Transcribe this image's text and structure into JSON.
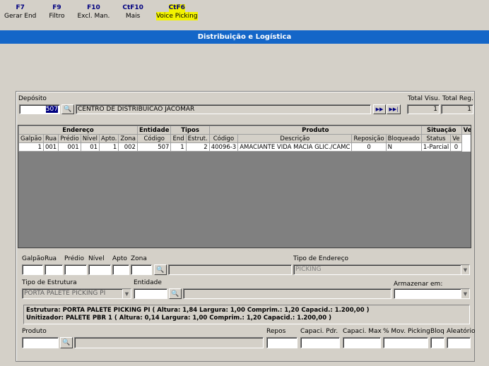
{
  "toolbar": [
    {
      "key": "F7",
      "label": "Gerar End",
      "highlight": false
    },
    {
      "key": "F9",
      "label": "Filtro",
      "highlight": false
    },
    {
      "key": "F10",
      "label": "Excl. Man.",
      "highlight": false
    },
    {
      "key": "CtF10",
      "label": "Mais",
      "highlight": false
    },
    {
      "key": "CtF6",
      "label": "Voice Picking",
      "highlight": true
    }
  ],
  "title": "Distribuição e Logística",
  "deposito": {
    "label": "Depósito",
    "code": "507",
    "name": "CENTRO DE DISTRIBUICAO JACOMAR"
  },
  "totals": {
    "visu_label": "Total Visu.",
    "reg_label": "Total Reg.",
    "visu": "1",
    "reg": "1"
  },
  "nav": {
    "next": "▶▶",
    "last": "▶▶|"
  },
  "grid": {
    "groups": [
      "Endereço",
      "Entidade",
      "Tipos",
      "Produto",
      "Situação",
      "Ve"
    ],
    "columns": [
      "Galpão",
      "Rua",
      "Prédio",
      "Nível",
      "Apto.",
      "Zona",
      "Código",
      "End",
      "Estrut.",
      "Código",
      "Descrição",
      "Reposição",
      "Bloqueado",
      "Status",
      "Ve"
    ],
    "rows": [
      [
        "1",
        "001",
        "001",
        "01",
        "1",
        "002",
        "507",
        "1",
        "2",
        "40096-3",
        "AMACIANTE VIDA MACIA GLIC./CAMC",
        "0",
        "N",
        "1-Parcial",
        "0"
      ]
    ]
  },
  "form": {
    "galpao": "Galpão",
    "rua": "Rua",
    "predio": "Prédio",
    "nivel": "Nível",
    "apto": "Apto",
    "zona": "Zona",
    "tipo_endereco_label": "Tipo de Endereço",
    "tipo_endereco": "PICKING",
    "tipo_estrutura_label": "Tipo de Estrutura",
    "tipo_estrutura": "PORTA PALETE PICKING PI",
    "entidade_label": "Entidade",
    "armazenar_label": "Armazenar em:",
    "info_line1": "Estrutura: PORTA PALETE PICKING PI ( Altura: 1,84  Largura: 1,00  Comprim.: 1,20  Capacid.: 1.200,00 )",
    "info_line2": "Unitizador: PALETE PBR 1 ( Altura: 0,14  Largura: 1,00  Comprim.: 1,20  Capacid.: 1.200,00 )",
    "produto_label": "Produto",
    "repos_label": "Repos",
    "capaci_pdr_label": "Capaci. Pdr.",
    "capaci_max_label": "Capaci. Max",
    "mov_picking_label": "% Mov. Picking",
    "bloq_label": "Bloq",
    "aleatorio_label": "Aleatório"
  },
  "icons": {
    "search": "binoculars-icon",
    "dropdown": "chevron-down-icon",
    "scroll_left": "◀",
    "scroll_right": "▶",
    "dd": "▼"
  }
}
